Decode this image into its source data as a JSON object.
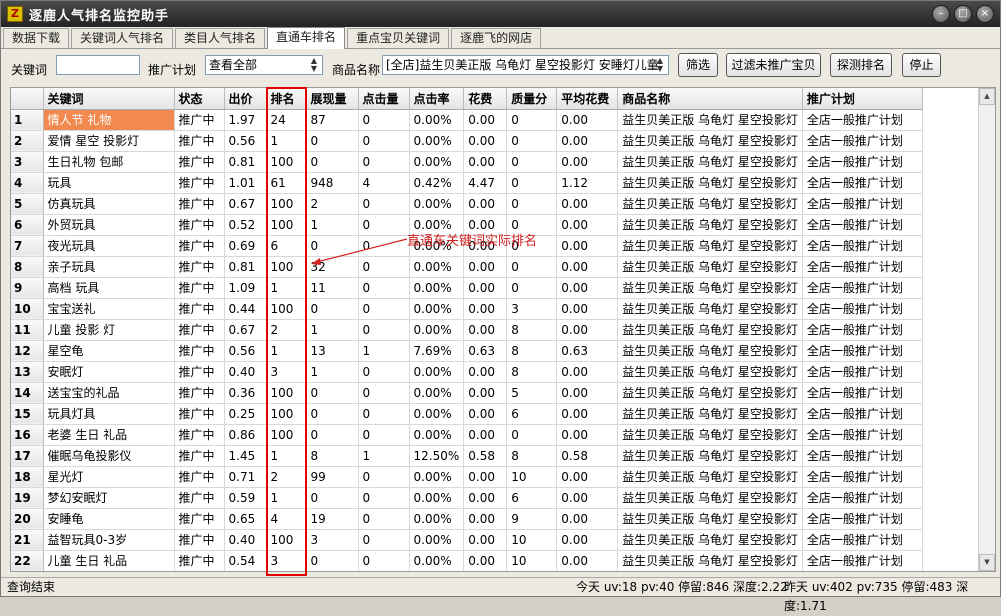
{
  "window": {
    "title": "逐鹿人气排名监控助手",
    "icon_text": "Z",
    "controls": [
      "–",
      "□",
      "×"
    ]
  },
  "tabs": [
    "数据下载",
    "关键词人气排名",
    "类目人气排名",
    "直通车排名",
    "重点宝贝关键词",
    "逐鹿飞的网店"
  ],
  "active_tab": "直通车排名",
  "toolbar": {
    "keyword_label": "关键词",
    "keyword_value": "",
    "plan_label": "推广计划",
    "plan_value": "查看全部",
    "product_label": "商品名称",
    "product_value": "[全店]益生贝美正版 乌龟灯 星空投影灯 安睡灯儿童",
    "filter_button": "筛选",
    "filter_unpromoted_button": "过滤未推广宝贝",
    "probe_rank_button": "探测排名",
    "stop_button": "停止"
  },
  "table": {
    "columns": [
      "",
      "关键词",
      "状态",
      "出价",
      "排名",
      "展现量",
      "点击量",
      "点击率",
      "花费",
      "质量分",
      "平均花费",
      "商品名称",
      "推广计划"
    ],
    "rows": [
      [
        "1",
        "情人节 礼物",
        "推广中",
        "1.97",
        "24",
        "87",
        "0",
        "0.00%",
        "0.00",
        "0",
        "0.00",
        "益生贝美正版 乌龟灯 星空投影灯",
        "全店一般推广计划"
      ],
      [
        "2",
        "爱情 星空 投影灯",
        "推广中",
        "0.56",
        "1",
        "0",
        "0",
        "0.00%",
        "0.00",
        "0",
        "0.00",
        "益生贝美正版 乌龟灯 星空投影灯",
        "全店一般推广计划"
      ],
      [
        "3",
        "生日礼物 包邮",
        "推广中",
        "0.81",
        "100",
        "0",
        "0",
        "0.00%",
        "0.00",
        "0",
        "0.00",
        "益生贝美正版 乌龟灯 星空投影灯",
        "全店一般推广计划"
      ],
      [
        "4",
        "玩具",
        "推广中",
        "1.01",
        "61",
        "948",
        "4",
        "0.42%",
        "4.47",
        "0",
        "1.12",
        "益生贝美正版 乌龟灯 星空投影灯",
        "全店一般推广计划"
      ],
      [
        "5",
        "仿真玩具",
        "推广中",
        "0.67",
        "100",
        "2",
        "0",
        "0.00%",
        "0.00",
        "0",
        "0.00",
        "益生贝美正版 乌龟灯 星空投影灯",
        "全店一般推广计划"
      ],
      [
        "6",
        "外贸玩具",
        "推广中",
        "0.52",
        "100",
        "1",
        "0",
        "0.00%",
        "0.00",
        "0",
        "0.00",
        "益生贝美正版 乌龟灯 星空投影灯",
        "全店一般推广计划"
      ],
      [
        "7",
        "夜光玩具",
        "推广中",
        "0.69",
        "6",
        "0",
        "0",
        "0.00%",
        "0.00",
        "0",
        "0.00",
        "益生贝美正版 乌龟灯 星空投影灯",
        "全店一般推广计划"
      ],
      [
        "8",
        "亲子玩具",
        "推广中",
        "0.81",
        "100",
        "32",
        "0",
        "0.00%",
        "0.00",
        "0",
        "0.00",
        "益生贝美正版 乌龟灯 星空投影灯",
        "全店一般推广计划"
      ],
      [
        "9",
        "高档 玩具",
        "推广中",
        "1.09",
        "1",
        "11",
        "0",
        "0.00%",
        "0.00",
        "0",
        "0.00",
        "益生贝美正版 乌龟灯 星空投影灯",
        "全店一般推广计划"
      ],
      [
        "10",
        "宝宝送礼",
        "推广中",
        "0.44",
        "100",
        "0",
        "0",
        "0.00%",
        "0.00",
        "3",
        "0.00",
        "益生贝美正版 乌龟灯 星空投影灯",
        "全店一般推广计划"
      ],
      [
        "11",
        "儿童 投影 灯",
        "推广中",
        "0.67",
        "2",
        "1",
        "0",
        "0.00%",
        "0.00",
        "8",
        "0.00",
        "益生贝美正版 乌龟灯 星空投影灯",
        "全店一般推广计划"
      ],
      [
        "12",
        "星空龟",
        "推广中",
        "0.56",
        "1",
        "13",
        "1",
        "7.69%",
        "0.63",
        "8",
        "0.63",
        "益生贝美正版 乌龟灯 星空投影灯",
        "全店一般推广计划"
      ],
      [
        "13",
        "安眠灯",
        "推广中",
        "0.40",
        "3",
        "1",
        "0",
        "0.00%",
        "0.00",
        "8",
        "0.00",
        "益生贝美正版 乌龟灯 星空投影灯",
        "全店一般推广计划"
      ],
      [
        "14",
        "送宝宝的礼品",
        "推广中",
        "0.36",
        "100",
        "0",
        "0",
        "0.00%",
        "0.00",
        "5",
        "0.00",
        "益生贝美正版 乌龟灯 星空投影灯",
        "全店一般推广计划"
      ],
      [
        "15",
        "玩具灯具",
        "推广中",
        "0.25",
        "100",
        "0",
        "0",
        "0.00%",
        "0.00",
        "6",
        "0.00",
        "益生贝美正版 乌龟灯 星空投影灯",
        "全店一般推广计划"
      ],
      [
        "16",
        "老婆 生日 礼品",
        "推广中",
        "0.86",
        "100",
        "0",
        "0",
        "0.00%",
        "0.00",
        "0",
        "0.00",
        "益生贝美正版 乌龟灯 星空投影灯",
        "全店一般推广计划"
      ],
      [
        "17",
        "催眠乌龟投影仪",
        "推广中",
        "1.45",
        "1",
        "8",
        "1",
        "12.50%",
        "0.58",
        "8",
        "0.58",
        "益生贝美正版 乌龟灯 星空投影灯",
        "全店一般推广计划"
      ],
      [
        "18",
        "星光灯",
        "推广中",
        "0.71",
        "2",
        "99",
        "0",
        "0.00%",
        "0.00",
        "10",
        "0.00",
        "益生贝美正版 乌龟灯 星空投影灯",
        "全店一般推广计划"
      ],
      [
        "19",
        "梦幻安眠灯",
        "推广中",
        "0.59",
        "1",
        "0",
        "0",
        "0.00%",
        "0.00",
        "6",
        "0.00",
        "益生贝美正版 乌龟灯 星空投影灯",
        "全店一般推广计划"
      ],
      [
        "20",
        "安睡龟",
        "推广中",
        "0.65",
        "4",
        "19",
        "0",
        "0.00%",
        "0.00",
        "9",
        "0.00",
        "益生贝美正版 乌龟灯 星空投影灯",
        "全店一般推广计划"
      ],
      [
        "21",
        "益智玩具0-3岁",
        "推广中",
        "0.40",
        "100",
        "3",
        "0",
        "0.00%",
        "0.00",
        "10",
        "0.00",
        "益生贝美正版 乌龟灯 星空投影灯",
        "全店一般推广计划"
      ],
      [
        "22",
        "儿童 生日 礼品",
        "推广中",
        "0.54",
        "3",
        "0",
        "0",
        "0.00%",
        "0.00",
        "10",
        "0.00",
        "益生贝美正版 乌龟灯 星空投影灯",
        "全店一般推广计划"
      ]
    ],
    "selected_row": 0
  },
  "annotation": {
    "text": "直通车关键词实际排名",
    "color": "#d02020"
  },
  "status": {
    "left": "查询结束",
    "today": "今天 uv:18 pv:40 停留:846 深度:2.22",
    "yesterday": "昨天 uv:402 pv:735 停留:483 深度:1.71"
  },
  "colors": {
    "selected_cell": "#f28a50",
    "highlight": "#e00000",
    "titlebar": "#232323"
  }
}
